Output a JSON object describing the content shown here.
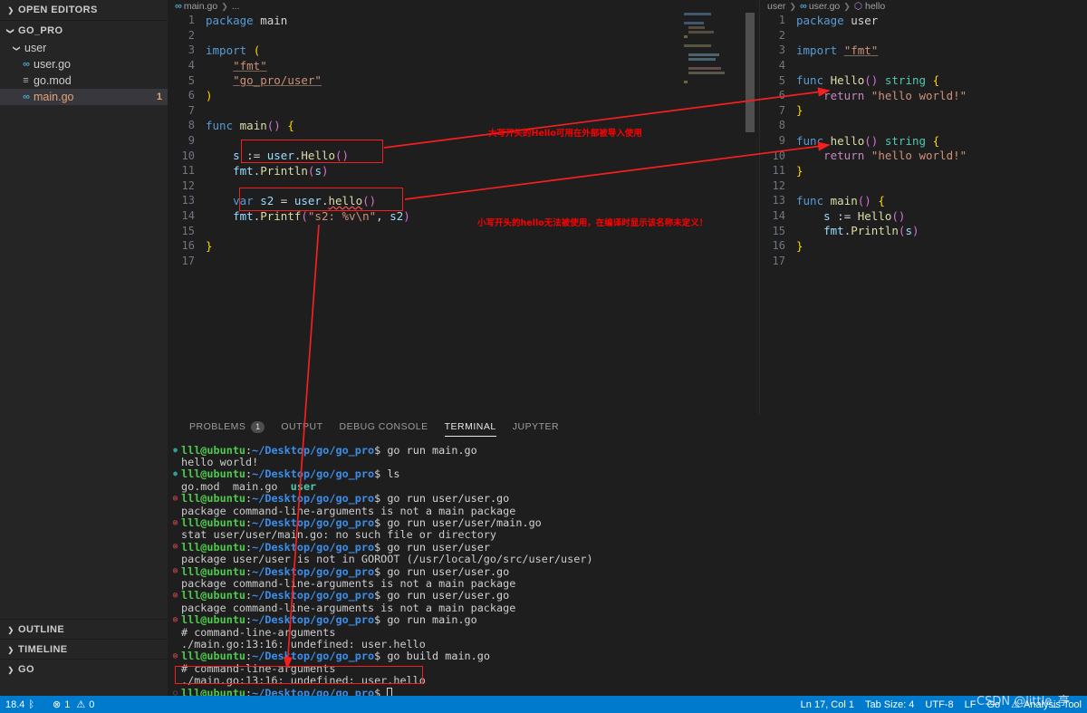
{
  "sidebar": {
    "open_editors_label": "OPEN EDITORS",
    "project_label": "GO_PRO",
    "tree": [
      {
        "label": "user",
        "type": "folder",
        "depth": 1,
        "icon": "chevron-down-icon",
        "badge": ""
      },
      {
        "label": "user.go",
        "type": "file",
        "depth": 2,
        "icon": "go-file-icon",
        "badge": ""
      },
      {
        "label": "go.mod",
        "type": "file",
        "depth": 2,
        "icon": "mod-file-icon",
        "badge": ""
      },
      {
        "label": "main.go",
        "type": "file",
        "depth": 2,
        "icon": "go-file-icon",
        "badge": "1",
        "selected": true,
        "modified": true
      }
    ],
    "bottom_sections": [
      "OUTLINE",
      "TIMELINE",
      "GO"
    ]
  },
  "editor_left": {
    "breadcrumb": [
      "main.go",
      "..."
    ],
    "lines": [
      {
        "n": 1,
        "tokens": [
          {
            "t": "package ",
            "c": "kw"
          },
          {
            "t": "main",
            "c": "plain"
          }
        ]
      },
      {
        "n": 2,
        "tokens": []
      },
      {
        "n": 3,
        "tokens": [
          {
            "t": "import ",
            "c": "kw"
          },
          {
            "t": "(",
            "c": "punc"
          }
        ]
      },
      {
        "n": 4,
        "tokens": [
          {
            "t": "    ",
            "c": "plain"
          },
          {
            "t": "\"fmt\"",
            "c": "imp"
          }
        ]
      },
      {
        "n": 5,
        "tokens": [
          {
            "t": "    ",
            "c": "plain"
          },
          {
            "t": "\"go_pro/user\"",
            "c": "imp"
          }
        ]
      },
      {
        "n": 6,
        "tokens": [
          {
            "t": ")",
            "c": "punc"
          }
        ]
      },
      {
        "n": 7,
        "tokens": []
      },
      {
        "n": 8,
        "tokens": [
          {
            "t": "func ",
            "c": "kw"
          },
          {
            "t": "main",
            "c": "fn"
          },
          {
            "t": "()",
            "c": "punc2"
          },
          {
            "t": " ",
            "c": "plain"
          },
          {
            "t": "{",
            "c": "punc"
          }
        ]
      },
      {
        "n": 9,
        "tokens": []
      },
      {
        "n": 10,
        "tokens": [
          {
            "t": "    ",
            "c": "plain"
          },
          {
            "t": "s",
            "c": "id"
          },
          {
            "t": " := ",
            "c": "plain"
          },
          {
            "t": "user",
            "c": "id"
          },
          {
            "t": ".",
            "c": "plain"
          },
          {
            "t": "Hello",
            "c": "fn"
          },
          {
            "t": "()",
            "c": "punc2"
          }
        ]
      },
      {
        "n": 11,
        "tokens": [
          {
            "t": "    ",
            "c": "plain"
          },
          {
            "t": "fmt",
            "c": "id"
          },
          {
            "t": ".",
            "c": "plain"
          },
          {
            "t": "Println",
            "c": "fn"
          },
          {
            "t": "(",
            "c": "punc2"
          },
          {
            "t": "s",
            "c": "id"
          },
          {
            "t": ")",
            "c": "punc2"
          }
        ]
      },
      {
        "n": 12,
        "tokens": []
      },
      {
        "n": 13,
        "tokens": [
          {
            "t": "    ",
            "c": "plain"
          },
          {
            "t": "var ",
            "c": "kw"
          },
          {
            "t": "s2",
            "c": "id"
          },
          {
            "t": " = ",
            "c": "plain"
          },
          {
            "t": "user",
            "c": "id"
          },
          {
            "t": ".",
            "c": "plain"
          },
          {
            "t": "hello",
            "c": "fn squiggle"
          },
          {
            "t": "()",
            "c": "punc2"
          }
        ]
      },
      {
        "n": 14,
        "tokens": [
          {
            "t": "    ",
            "c": "plain"
          },
          {
            "t": "fmt",
            "c": "id"
          },
          {
            "t": ".",
            "c": "plain"
          },
          {
            "t": "Printf",
            "c": "fn"
          },
          {
            "t": "(",
            "c": "punc2"
          },
          {
            "t": "\"s2: %v\\n\"",
            "c": "str"
          },
          {
            "t": ", ",
            "c": "plain"
          },
          {
            "t": "s2",
            "c": "id"
          },
          {
            "t": ")",
            "c": "punc2"
          }
        ]
      },
      {
        "n": 15,
        "tokens": []
      },
      {
        "n": 16,
        "tokens": [
          {
            "t": "}",
            "c": "punc"
          }
        ]
      },
      {
        "n": 17,
        "tokens": []
      }
    ]
  },
  "editor_right": {
    "breadcrumb": [
      "user",
      "user.go",
      "hello"
    ],
    "lines": [
      {
        "n": 1,
        "tokens": [
          {
            "t": "package ",
            "c": "kw"
          },
          {
            "t": "user",
            "c": "plain"
          }
        ]
      },
      {
        "n": 2,
        "tokens": []
      },
      {
        "n": 3,
        "tokens": [
          {
            "t": "import ",
            "c": "kw"
          },
          {
            "t": "\"fmt\"",
            "c": "imp"
          }
        ]
      },
      {
        "n": 4,
        "tokens": []
      },
      {
        "n": 5,
        "tokens": [
          {
            "t": "func ",
            "c": "kw"
          },
          {
            "t": "Hello",
            "c": "fn"
          },
          {
            "t": "()",
            "c": "punc2"
          },
          {
            "t": " ",
            "c": "plain"
          },
          {
            "t": "string",
            "c": "ty"
          },
          {
            "t": " ",
            "c": "plain"
          },
          {
            "t": "{",
            "c": "punc"
          }
        ]
      },
      {
        "n": 6,
        "tokens": [
          {
            "t": "    ",
            "c": "plain"
          },
          {
            "t": "return ",
            "c": "kw2"
          },
          {
            "t": "\"hello world!\"",
            "c": "str"
          }
        ]
      },
      {
        "n": 7,
        "tokens": [
          {
            "t": "}",
            "c": "punc"
          }
        ]
      },
      {
        "n": 8,
        "tokens": []
      },
      {
        "n": 9,
        "tokens": [
          {
            "t": "func ",
            "c": "kw"
          },
          {
            "t": "hello",
            "c": "fn"
          },
          {
            "t": "()",
            "c": "punc2"
          },
          {
            "t": " ",
            "c": "plain"
          },
          {
            "t": "string",
            "c": "ty"
          },
          {
            "t": " ",
            "c": "plain"
          },
          {
            "t": "{",
            "c": "punc"
          }
        ]
      },
      {
        "n": 10,
        "tokens": [
          {
            "t": "    ",
            "c": "plain"
          },
          {
            "t": "return ",
            "c": "kw2"
          },
          {
            "t": "\"hello world!\"",
            "c": "str"
          }
        ]
      },
      {
        "n": 11,
        "tokens": [
          {
            "t": "}",
            "c": "punc"
          }
        ]
      },
      {
        "n": 12,
        "tokens": []
      },
      {
        "n": 13,
        "tokens": [
          {
            "t": "func ",
            "c": "kw"
          },
          {
            "t": "main",
            "c": "fn"
          },
          {
            "t": "()",
            "c": "punc2"
          },
          {
            "t": " ",
            "c": "plain"
          },
          {
            "t": "{",
            "c": "punc"
          }
        ]
      },
      {
        "n": 14,
        "tokens": [
          {
            "t": "    ",
            "c": "plain"
          },
          {
            "t": "s",
            "c": "id"
          },
          {
            "t": " := ",
            "c": "plain"
          },
          {
            "t": "Hello",
            "c": "fn"
          },
          {
            "t": "()",
            "c": "punc2"
          }
        ]
      },
      {
        "n": 15,
        "tokens": [
          {
            "t": "    ",
            "c": "plain"
          },
          {
            "t": "fmt",
            "c": "id"
          },
          {
            "t": ".",
            "c": "plain"
          },
          {
            "t": "Println",
            "c": "fn"
          },
          {
            "t": "(",
            "c": "punc2"
          },
          {
            "t": "s",
            "c": "id"
          },
          {
            "t": ")",
            "c": "punc2"
          }
        ]
      },
      {
        "n": 16,
        "tokens": [
          {
            "t": "}",
            "c": "punc"
          }
        ]
      },
      {
        "n": 17,
        "tokens": []
      }
    ]
  },
  "panel": {
    "tabs": [
      {
        "label": "PROBLEMS",
        "count": "1",
        "active": false
      },
      {
        "label": "OUTPUT",
        "count": "",
        "active": false
      },
      {
        "label": "DEBUG CONSOLE",
        "count": "",
        "active": false
      },
      {
        "label": "TERMINAL",
        "count": "",
        "active": true
      },
      {
        "label": "JUPYTER",
        "count": "",
        "active": false
      }
    ],
    "prompt_user": "lll@ubuntu",
    "prompt_path": "~/Desktop/go/go_pro",
    "terminal_lines": [
      {
        "kind": "prompt",
        "status": "ok",
        "cmd": "go run main.go"
      },
      {
        "kind": "out",
        "text": "hello world!"
      },
      {
        "kind": "prompt",
        "status": "ok",
        "cmd": "ls"
      },
      {
        "kind": "ls",
        "text": "go.mod  main.go  ",
        "dir": "user"
      },
      {
        "kind": "prompt",
        "status": "err",
        "cmd": "go run user/user.go"
      },
      {
        "kind": "out",
        "text": "package command-line-arguments is not a main package"
      },
      {
        "kind": "prompt",
        "status": "err",
        "cmd": "go run user/user/main.go"
      },
      {
        "kind": "out",
        "text": "stat user/user/main.go: no such file or directory"
      },
      {
        "kind": "prompt",
        "status": "err",
        "cmd": "go run user/user"
      },
      {
        "kind": "out",
        "text": "package user/user is not in GOROOT (/usr/local/go/src/user/user)"
      },
      {
        "kind": "prompt",
        "status": "err",
        "cmd": "go run user/user.go"
      },
      {
        "kind": "out",
        "text": "package command-line-arguments is not a main package"
      },
      {
        "kind": "prompt",
        "status": "err",
        "cmd": "go run user/user.go"
      },
      {
        "kind": "out",
        "text": "package command-line-arguments is not a main package"
      },
      {
        "kind": "prompt",
        "status": "err",
        "cmd": "go run main.go"
      },
      {
        "kind": "out",
        "text": "# command-line-arguments"
      },
      {
        "kind": "out",
        "text": "./main.go:13:16: undefined: user.hello"
      },
      {
        "kind": "prompt",
        "status": "err",
        "cmd": "go build main.go"
      },
      {
        "kind": "out",
        "text": "# command-line-arguments"
      },
      {
        "kind": "out",
        "text": "./main.go:13:16: undefined: user.hello"
      },
      {
        "kind": "prompt",
        "status": "dim",
        "cmd": "",
        "cursor": true
      }
    ]
  },
  "statusbar": {
    "left": [
      {
        "label": "18.4",
        "icon": "branch-icon"
      },
      {
        "label": "1",
        "icon": "error-icon"
      },
      {
        "label": "0",
        "icon": "warning-icon"
      }
    ],
    "right": [
      {
        "label": "Ln 17, Col 1"
      },
      {
        "label": "Tab Size: 4"
      },
      {
        "label": "UTF-8"
      },
      {
        "label": "LF"
      },
      {
        "label": "Go"
      },
      {
        "label": "Analysis Tool",
        "icon": "warning-icon"
      }
    ]
  },
  "annotations": {
    "note_hello_upper": "大写开头的Hello可用在外部被导入使用",
    "note_hello_lower": "小写开头的hello无法被使用，在编译时显示该名称未定义！",
    "watermark": "CSDN @little_亭"
  }
}
